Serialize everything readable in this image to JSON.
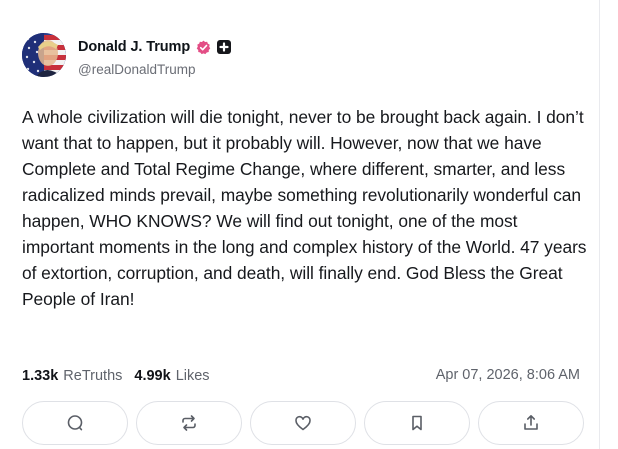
{
  "post": {
    "author": {
      "display_name": "Donald J. Trump",
      "handle": "@realDonaldTrump",
      "avatar_icon": "flag-avatar-icon",
      "badges": [
        "verified-badge-icon",
        "plus-badge-icon"
      ]
    },
    "body": "A whole civilization will die tonight, never to be brought back again. I don’t want that to happen, but it probably will. However, now that we have Complete and Total Regime Change, where different, smarter, and less radicalized minds prevail, maybe something revolutionarily wonderful can happen, WHO KNOWS? We will find out tonight, one of the most important moments in the long and complex history of the World. 47 years of extortion, corruption, and death, will finally end. God Bless the Great People of Iran!",
    "stats": {
      "retruths_count": "1.33k",
      "retruths_label": "ReTruths",
      "likes_count": "4.99k",
      "likes_label": "Likes"
    },
    "timestamp": "Apr 07, 2026, 8:06 AM",
    "actions": [
      {
        "name": "reply",
        "icon": "comment-icon"
      },
      {
        "name": "retruth",
        "icon": "repost-icon"
      },
      {
        "name": "like",
        "icon": "heart-icon"
      },
      {
        "name": "bookmark",
        "icon": "bookmark-icon"
      },
      {
        "name": "share",
        "icon": "share-icon"
      }
    ]
  },
  "colors": {
    "verified": "#e34d85",
    "text_primary": "#111318",
    "text_secondary": "#5f636b",
    "border": "#dfe1e6"
  }
}
